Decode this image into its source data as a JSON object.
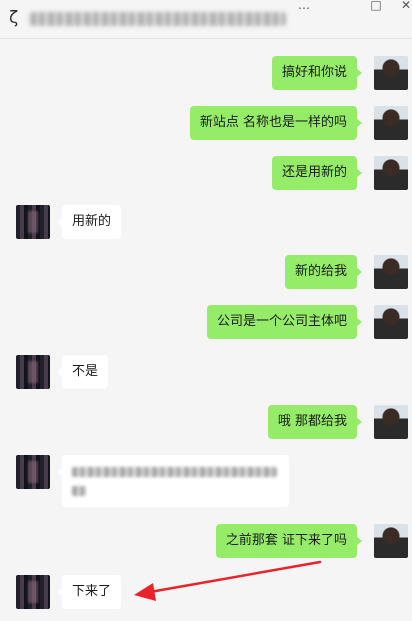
{
  "window": {
    "title": "",
    "title_glyph": "ζ",
    "controls": [
      "…",
      "□",
      "✕"
    ]
  },
  "messages": [
    {
      "side": "me",
      "text": "搞好和你说"
    },
    {
      "side": "me",
      "text": "新站点 名称也是一样的吗"
    },
    {
      "side": "me",
      "text": "还是用新的"
    },
    {
      "side": "other",
      "text": "用新的"
    },
    {
      "side": "me",
      "text": "新的给我"
    },
    {
      "side": "me",
      "text": "公司是一个公司主体吧"
    },
    {
      "side": "other",
      "text": "不是"
    },
    {
      "side": "me",
      "text": "哦 那都给我"
    },
    {
      "side": "other",
      "text": "",
      "blurred": true
    },
    {
      "side": "me",
      "text": "之前那套 证下来了吗"
    },
    {
      "side": "other",
      "text": "下来了"
    }
  ],
  "annotation": {
    "type": "arrow",
    "color": "#e8232a"
  }
}
